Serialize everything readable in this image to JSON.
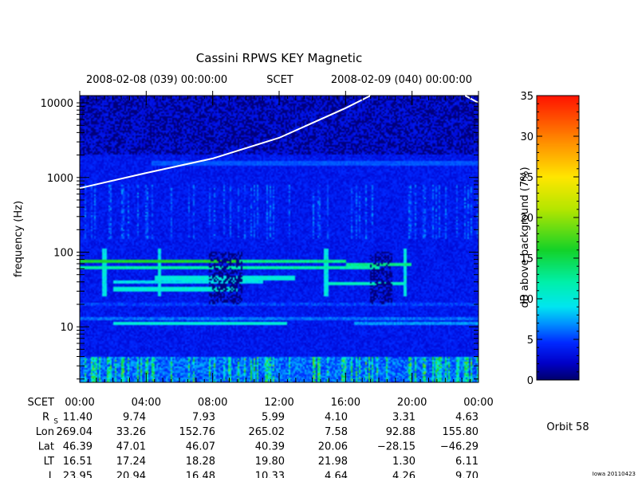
{
  "title": "Cassini RPWS KEY Magnetic",
  "header": {
    "start_time": "2008-02-08 (039) 00:00:00",
    "scet_label": "SCET",
    "end_time": "2008-02-09 (040) 00:00:00"
  },
  "chart_data": {
    "type": "heatmap",
    "title": "Cassini RPWS KEY Magnetic",
    "ylabel": "frequency (Hz)",
    "yscale": "log",
    "ylim": [
      1.8,
      12500
    ],
    "y_ticks": [
      "10",
      "100",
      "1000",
      "10000"
    ],
    "x_ticks": [
      "00:00",
      "04:00",
      "08:00",
      "12:00",
      "16:00",
      "20:00",
      "00:00"
    ],
    "colorbar": {
      "label": "dB above background (7%)",
      "range": [
        0,
        35
      ],
      "ticks": [
        "0",
        "5",
        "10",
        "15",
        "20",
        "25",
        "30",
        "35"
      ]
    },
    "curve": {
      "description": "white line",
      "points": [
        [
          0,
          720
        ],
        [
          4,
          1150
        ],
        [
          8,
          1800
        ],
        [
          12,
          3400
        ],
        [
          16,
          8500
        ],
        [
          17.5,
          12500
        ]
      ],
      "points_tail": [
        [
          23.2,
          12500
        ],
        [
          24,
          10000
        ]
      ]
    },
    "bands": [
      {
        "hz": 75,
        "level": 15,
        "from": 0.0,
        "to": 9.5
      },
      {
        "hz": 75,
        "level": 12,
        "from": 9.5,
        "to": 16.0
      },
      {
        "hz": 68,
        "level": 12,
        "from": 16.0,
        "to": 20.0
      },
      {
        "hz": 62,
        "level": 11,
        "from": 0.0,
        "to": 18.0
      },
      {
        "hz": 45,
        "level": 9,
        "from": 4.5,
        "to": 13.0
      },
      {
        "hz": 40,
        "level": 8,
        "from": 2.0,
        "to": 11.0
      },
      {
        "hz": 38,
        "level": 10,
        "from": 15.0,
        "to": 19.5
      },
      {
        "hz": 32,
        "level": 9,
        "from": 2.0,
        "to": 9.5
      },
      {
        "hz": 11,
        "level": 9,
        "from": 2.0,
        "to": 12.5
      },
      {
        "hz": 11,
        "level": 6,
        "from": 16.5,
        "to": 24.0
      },
      {
        "hz": 13,
        "level": 5,
        "from": 0.0,
        "to": 24.0
      },
      {
        "hz": 20,
        "level": 4,
        "from": 0.0,
        "to": 24.0
      }
    ],
    "ephemeris": {
      "rows": [
        {
          "label": "SCET",
          "values": [
            "00:00",
            "04:00",
            "08:00",
            "12:00",
            "16:00",
            "20:00",
            "00:00"
          ]
        },
        {
          "label": "R",
          "sub": "S",
          "values": [
            "11.40",
            "9.74",
            "7.93",
            "5.99",
            "4.10",
            "3.31",
            "4.63"
          ]
        },
        {
          "label": "Lon",
          "values": [
            "269.04",
            "33.26",
            "152.76",
            "265.02",
            "7.58",
            "92.88",
            "155.80"
          ]
        },
        {
          "label": "Lat",
          "values": [
            "46.39",
            "47.01",
            "46.07",
            "40.39",
            "20.06",
            "−28.15",
            "−46.29"
          ]
        },
        {
          "label": "LT",
          "values": [
            "16.51",
            "17.24",
            "18.28",
            "19.80",
            "21.98",
            "1.30",
            "6.11"
          ]
        },
        {
          "label": "L",
          "values": [
            "23.95",
            "20.94",
            "16.48",
            "10.33",
            "4.64",
            "4.26",
            "9.70"
          ]
        }
      ]
    }
  },
  "orbit_label": "Orbit 58",
  "credit": "Iowa 20110423"
}
